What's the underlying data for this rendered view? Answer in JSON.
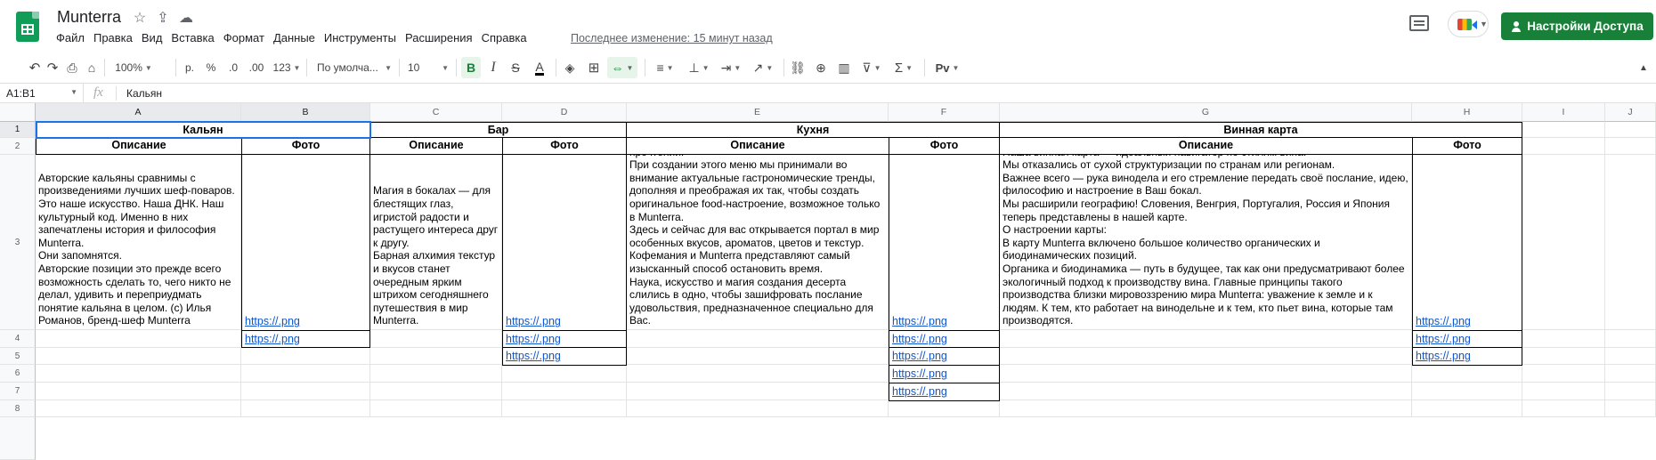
{
  "app": {
    "doc_title": "Munterra",
    "menu": [
      "Файл",
      "Правка",
      "Вид",
      "Вставка",
      "Формат",
      "Данные",
      "Инструменты",
      "Расширения",
      "Справка"
    ],
    "last_edit": "Последнее изменение: 15 минут назад",
    "share_label": "Настройки Доступа",
    "icons": [
      "star-icon",
      "move-to-drive-icon",
      "cloud-status-icon",
      "comments-icon",
      "meet-icon"
    ]
  },
  "toolbar": {
    "zoom": "100%",
    "currency": "р.",
    "percent": "%",
    "dec_decrease": ".0",
    "dec_increase": ".00",
    "more_formats": "123",
    "font": "По умолча...",
    "font_size": "10",
    "bold": "B",
    "italic": "I",
    "strike": "S",
    "text_color": "A",
    "sigma": "Σ",
    "input_tools": "Рv"
  },
  "formula_bar": {
    "name_box": "A1:B1",
    "fx": "fx",
    "content": "Кальян"
  },
  "grid": {
    "columns": [
      "A",
      "B",
      "C",
      "D",
      "E",
      "F",
      "G",
      "H",
      "I",
      "J"
    ],
    "rows": [
      "1",
      "2",
      "3",
      "4",
      "5",
      "6",
      "7",
      "8"
    ],
    "row1": {
      "kalyan": "Кальян",
      "bar": "Бар",
      "kitchen": "Кухня",
      "wine": "Винная карта"
    },
    "row2": {
      "a": "Описание",
      "b": "Фото",
      "c": "Описание",
      "d": "Фото",
      "e": "Описание",
      "f": "Фото",
      "g": "Описание",
      "h": "Фото"
    },
    "row3": {
      "a": "Авторские кальяны сравнимы с произведениями лучших шеф-поваров. Это наше искусство. Наша ДНК. Наш культурный код. Именно в них запечатлены история и философия Munterra.\nОни запомнятся.\nАвторские позиции это прежде всего возможность сделать то, чего никто не делал, удивить и переприудмать понятие кальяна в целом. (с) Илья Романов, бренд-шеф Munterra",
      "b": "https://.png",
      "c": "Магия в бокалах — для блестящих глаз, игристой радости и растущего интереса друг к другу.\nБарная алхимия текстур и вкусов станет очередным ярким штрихом сегодняшнего путешествия в мир Munterra.",
      "d": "https://.png",
      "e": "Меню Munterra — симбиоз блюд европейской, паназиатской и итальянской кухонь в авторском прочтении.\nПри создании этого меню мы принимали во внимание актуальные гастрономические тренды, дополняя и преображая их так, чтобы создать оригинальное food-настроение, возможное только в Munterra.\nЗдесь и сейчас для вас открывается портал в мир особенных вкусов, ароматов, цветов и текстур. Кофемания и Munterra представляют самый изысканный способ остановить время.\nНаука, искусство и магия создания десерта слились в одно, чтобы зашифровать послание удовольствия, предназначенное специально для Вас.",
      "f": "https://.png",
      "g": "Наша винная карта — идеальный навигатор по стилям вина.\nМы отказались от сухой структуризации по странам или регионам.\nВажнее всего — рука винодела и его стремление передать своё послание, идею, философию и настроение в Ваш бокал.\nМы расширили географию! Словения, Венгрия, Португалия, Россия и Япония теперь представлены в нашей карте.\nО настроении карты:\nВ карту Munterra включено большое количество органических и биодинамических позиций.\nОрганика и биодинамика — путь в будущее, так как они предусматривают более экологичный подход к производству вина. Главные принципы такого производства близки мировоззрению мира Munterra: уважение к земле и к людям. К тем, кто работает на винодельне и к тем, кто пьет вина, которые там производятся.",
      "h": "https://.png"
    },
    "row4": {
      "b": "https://.png",
      "d": "https://.png",
      "f": "https://.png",
      "h": "https://.png"
    },
    "row5": {
      "d": "https://.png",
      "f": "https://.png",
      "h": "https://.png"
    },
    "row6": {
      "f": "https://.png"
    },
    "row7": {
      "f": "https://.png"
    }
  }
}
